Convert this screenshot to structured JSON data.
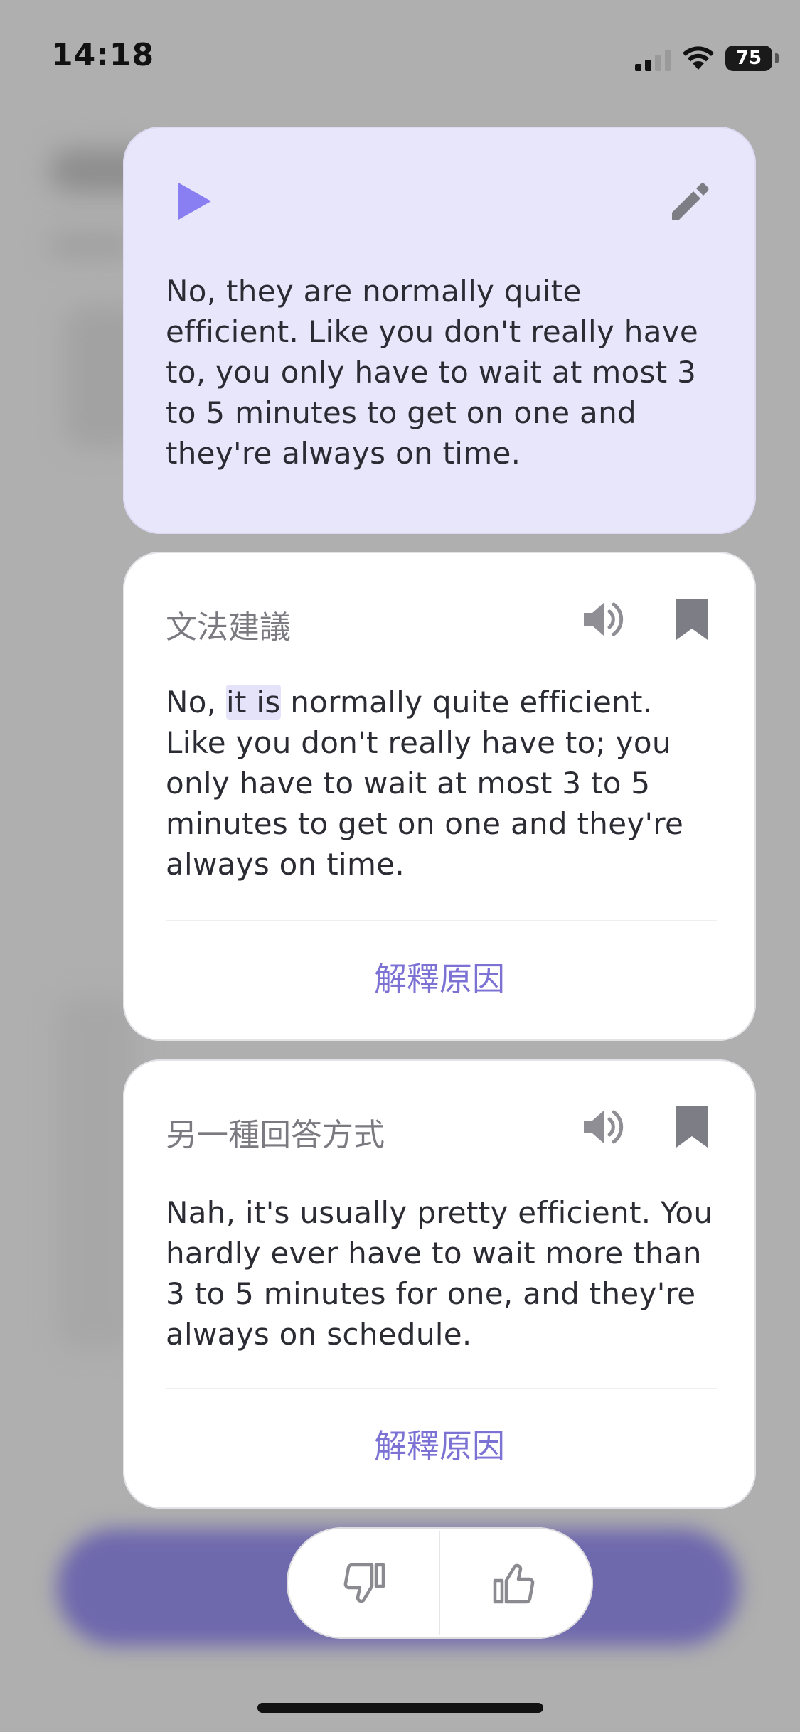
{
  "status_bar": {
    "time": "14:18",
    "battery": "75"
  },
  "user_message": {
    "text": "No, they are normally quite efficient. Like you don't really have to, you only have to wait at most 3 to 5 minutes to get on one and they're always on time.",
    "play_icon": "play-icon",
    "edit_icon": "pencil-icon"
  },
  "grammar_card": {
    "label": "文法建議",
    "text_before": "No, ",
    "text_highlight": "it is",
    "text_after": " normally quite efficient. Like you don't really have to; you only have to wait at most 3 to 5 minutes to get on one and they're always on time.",
    "explain_label": "解釋原因"
  },
  "alt_card": {
    "label": "另一種回答方式",
    "text": "Nah, it's usually pretty efficient. You hardly ever have to wait more than 3 to 5 minutes for one, and they're always on schedule.",
    "explain_label": "解釋原因"
  },
  "feedback": {
    "thumbs_down_icon": "thumbs-down-icon",
    "thumbs_up_icon": "thumbs-up-icon"
  },
  "colors": {
    "accent": "#8a7ff2",
    "user_card_bg": "#e7e6fb",
    "link": "#7b72d4",
    "highlight": "#e4e3fa"
  }
}
